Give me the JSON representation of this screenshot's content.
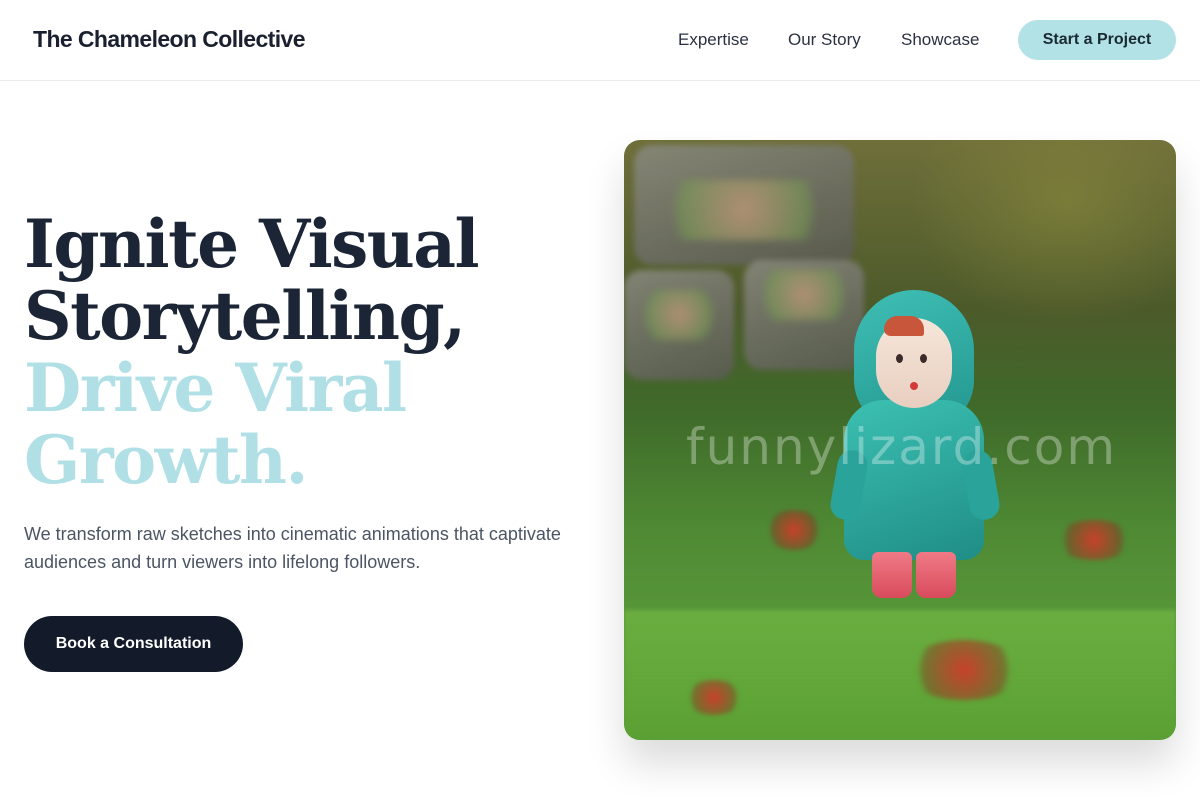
{
  "header": {
    "brand": "The Chameleon Collective",
    "nav": [
      "Expertise",
      "Our Story",
      "Showcase"
    ],
    "cta_label": "Start a Project"
  },
  "hero": {
    "headline_line1": "Ignite Visual",
    "headline_line2": "Storytelling,",
    "headline_accent_line1": "Drive Viral",
    "headline_accent_line2": "Growth.",
    "subtext": "We transform raw sketches into cinematic animations that captivate audiences and turn viewers into lifelong followers.",
    "cta_label": "Book a Consultation",
    "image_watermark": "funnylizard.com"
  },
  "colors": {
    "accent": "#b0e0e6",
    "dark": "#131a2a",
    "text": "#1b2535",
    "muted": "#4b5563"
  }
}
